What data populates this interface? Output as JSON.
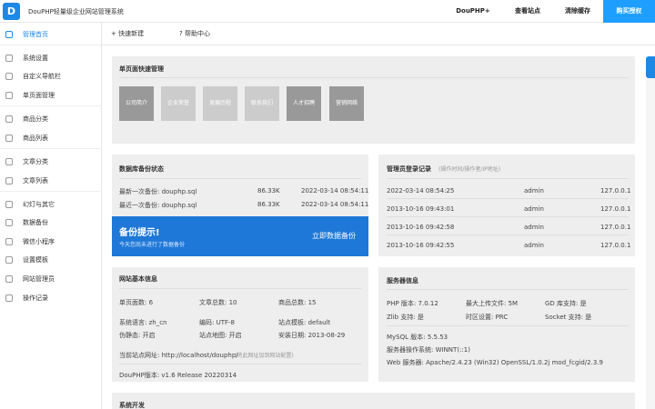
{
  "topbar": {
    "logo_letter": "D",
    "site_name": "DouPHP轻量级企业网站管理系统",
    "nav": [
      "DouPHP+",
      "查看站点",
      "清除缓存"
    ],
    "buy_label": "购买授权"
  },
  "sidebar": {
    "items": [
      {
        "label": "管理首页",
        "icon": "home-icon",
        "active": true
      },
      {
        "label": "系统设置",
        "icon": "gear-icon"
      },
      {
        "label": "自定义导航栏",
        "icon": "share-icon"
      },
      {
        "label": "单页面管理",
        "icon": "page-icon"
      },
      {
        "label": "商品分类",
        "icon": "grid-icon"
      },
      {
        "label": "商品列表",
        "icon": "grid-icon"
      },
      {
        "label": "文章分类",
        "icon": "book-icon"
      },
      {
        "label": "文章列表",
        "icon": "file-icon"
      },
      {
        "label": "幻灯与其它",
        "icon": "image-icon"
      },
      {
        "label": "数据备份",
        "icon": "refresh-icon"
      },
      {
        "label": "微信小程序",
        "icon": "wechat-icon"
      },
      {
        "label": "设置模板",
        "icon": "template-icon"
      },
      {
        "label": "网站管理员",
        "icon": "user-icon"
      },
      {
        "label": "操作记录",
        "icon": "clock-icon"
      }
    ]
  },
  "subbar": {
    "quick_new": "+ 快速新建",
    "help": "? 帮助中心"
  },
  "single_page": {
    "title": "单页面快速管理",
    "tiles": [
      "公司简介",
      "企业荣誉",
      "发展历程",
      "联系我们",
      "人才招聘",
      "营销网络"
    ]
  },
  "backup": {
    "title": "数据库备份状态",
    "rows": [
      {
        "label": "最新一次备份: douphp.sql",
        "size": "86.33K",
        "time": "2022-03-14 08:54:11"
      },
      {
        "label": "最近一次备份: douphp.sql",
        "size": "86.33K",
        "time": "2022-03-14 08:54:11"
      }
    ],
    "banner_title": "备份提示!",
    "banner_sub": "今天您尚未进行了数据备份",
    "banner_action": "立即数据备份"
  },
  "login_log": {
    "title": "管理员登录记录",
    "subtitle": "(操作时间/操作者/IP地址)",
    "rows": [
      {
        "time": "2022-03-14 08:54:25",
        "user": "admin",
        "ip": "127.0.0.1"
      },
      {
        "time": "2013-10-16 09:43:01",
        "user": "admin",
        "ip": "127.0.0.1"
      },
      {
        "time": "2013-10-16 09:42:58",
        "user": "admin",
        "ip": "127.0.0.1"
      },
      {
        "time": "2013-10-16 09:42:55",
        "user": "admin",
        "ip": "127.0.0.1"
      }
    ]
  },
  "site_info": {
    "title": "网站基本信息",
    "single_pages": "单页面数: 6",
    "articles": "文章总数: 10",
    "products": "商品总数: 15",
    "language": "系统语言: zh_cn",
    "encoding": "编码: UTF-8",
    "template": "站点模板: default",
    "rewrite": "伪静态: 开启",
    "sitemap": "站点地图: 开启",
    "install_date": "安装日期: 2013-08-29",
    "url_label": "当前站点网址: http://localhost/douphp/",
    "url_note": "(将此网址加到网站配置)",
    "version": "DouPHP版本: v1.6 Release 20220314"
  },
  "server_info": {
    "title": "服务器信息",
    "php_version": "PHP 版本: 7.0.12",
    "max_upload": "最大上传文件: 5M",
    "gd": "GD 库支持: 是",
    "zlib": "Zlib 支持: 是",
    "timezone": "时区设置: PRC",
    "socket": "Socket 支持: 是",
    "mysql": "MySQL 版本: 5.5.53",
    "os": "服务器操作系统: WINNT(::1)",
    "web_server": "Web 服务器: Apache/2.4.23 (Win32) OpenSSL/1.0.2j mod_fcgid/2.3.9"
  },
  "dev_panel": {
    "title": "系统开发"
  }
}
